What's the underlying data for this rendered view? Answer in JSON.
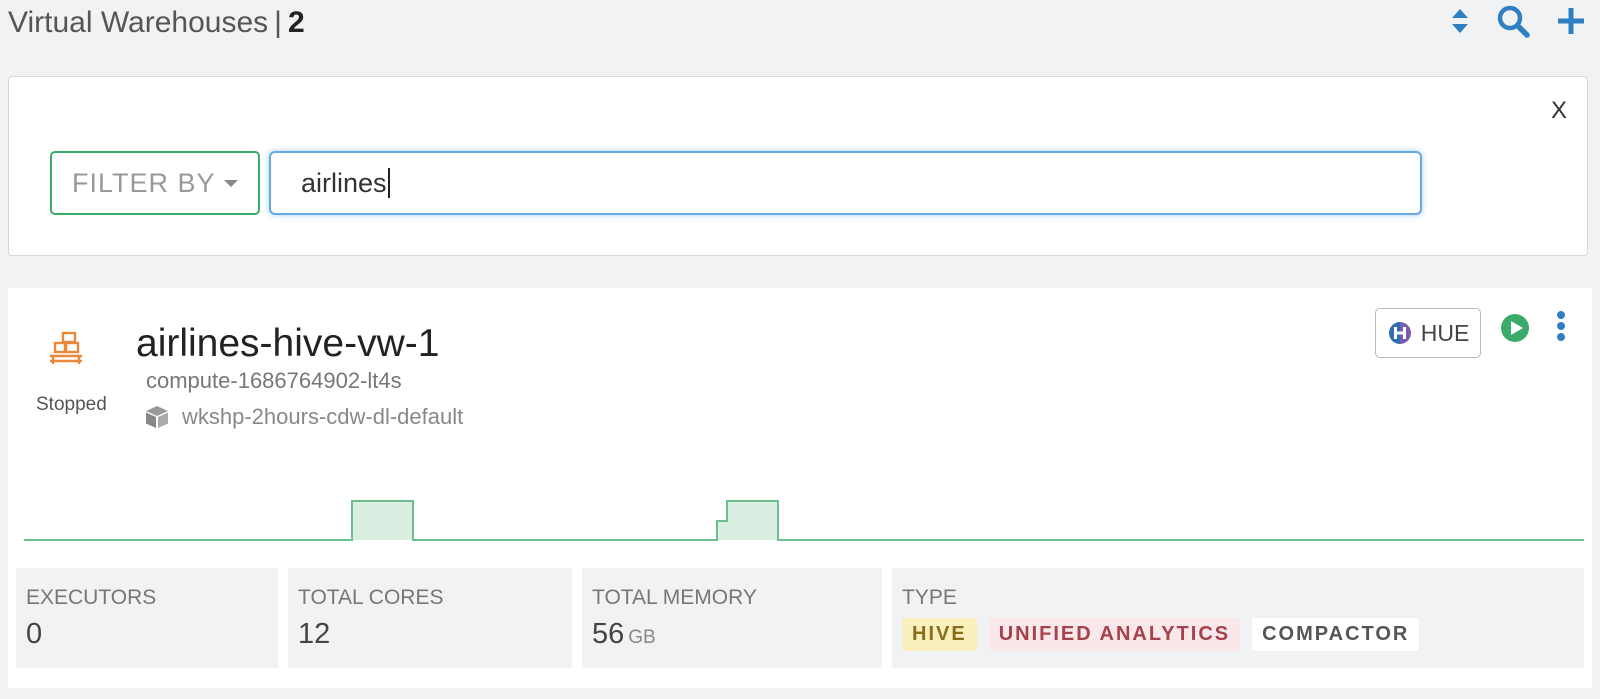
{
  "header": {
    "title": "Virtual Warehouses",
    "separator": "|",
    "count": "2",
    "icons": [
      "sort-icon",
      "search-icon",
      "plus-icon"
    ]
  },
  "filter": {
    "close_label": "X",
    "filter_by_label": "FILTER BY",
    "search_value": "airlines"
  },
  "warehouse": {
    "name": "airlines-hive-vw-1",
    "compute_id": "compute-1686764902-lt4s",
    "database": "wkshp-2hours-cdw-dl-default",
    "status": "Stopped",
    "hue_label": "HUE",
    "metrics": {
      "executors_label": "EXECUTORS",
      "executors_value": "0",
      "cores_label": "TOTAL CORES",
      "cores_value": "12",
      "memory_label": "TOTAL MEMORY",
      "memory_value": "56",
      "memory_unit": "GB",
      "type_label": "TYPE"
    },
    "type_badges": [
      "HIVE",
      "UNIFIED ANALYTICS",
      "COMPACTOR"
    ]
  },
  "colors": {
    "accent_blue": "#2f80c2",
    "accent_green": "#3bab6a",
    "warehouse_icon": "#e8883a"
  }
}
